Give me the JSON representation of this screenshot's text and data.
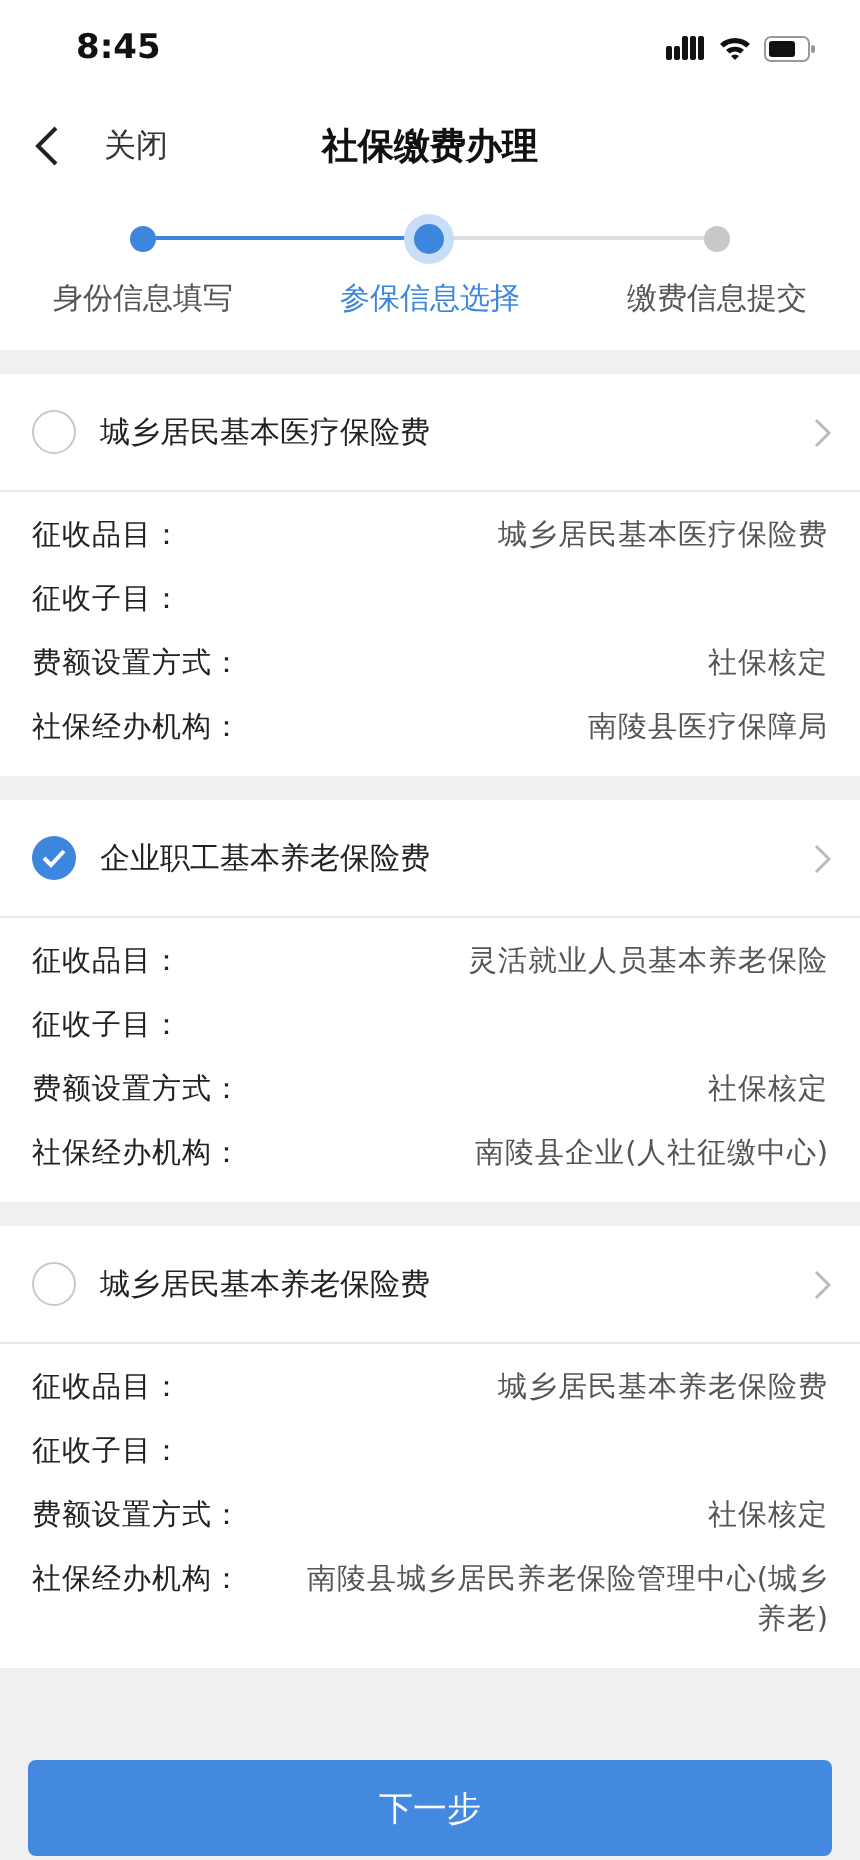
{
  "status_bar": {
    "time": "8:45"
  },
  "nav": {
    "close": "关闭",
    "title": "社保缴费办理"
  },
  "steps": [
    {
      "label": "身份信息填写",
      "done": true,
      "selected": false
    },
    {
      "label": "参保信息选择",
      "done": false,
      "selected": true
    },
    {
      "label": "缴费信息提交",
      "done": false,
      "selected": false
    }
  ],
  "insurances": [
    {
      "title": "城乡居民基本医疗保险费",
      "checked": false,
      "fields": [
        {
          "label": "征收品目：",
          "value": "城乡居民基本医疗保险费"
        },
        {
          "label": "征收子目："
        },
        {
          "label": "费额设置方式：",
          "value": "社保核定"
        },
        {
          "label": "社保经办机构：",
          "value": "南陵县医疗保障局"
        }
      ]
    },
    {
      "title": "企业职工基本养老保险费",
      "checked": true,
      "fields": [
        {
          "label": "征收品目：",
          "value": "灵活就业人员基本养老保险"
        },
        {
          "label": "征收子目："
        },
        {
          "label": "费额设置方式：",
          "value": "社保核定"
        },
        {
          "label": "社保经办机构：",
          "value": "南陵县企业(人社征缴中心)"
        }
      ]
    },
    {
      "title": "城乡居民基本养老保险费",
      "checked": false,
      "fields": [
        {
          "label": "征收品目：",
          "value": "城乡居民基本养老保险费"
        },
        {
          "label": "征收子目："
        },
        {
          "label": "费额设置方式：",
          "value": "社保核定"
        },
        {
          "label": "社保经办机构：",
          "value": "南陵县城乡居民养老保险管理中心(城乡养老)"
        }
      ]
    }
  ],
  "next_button": "下一步"
}
